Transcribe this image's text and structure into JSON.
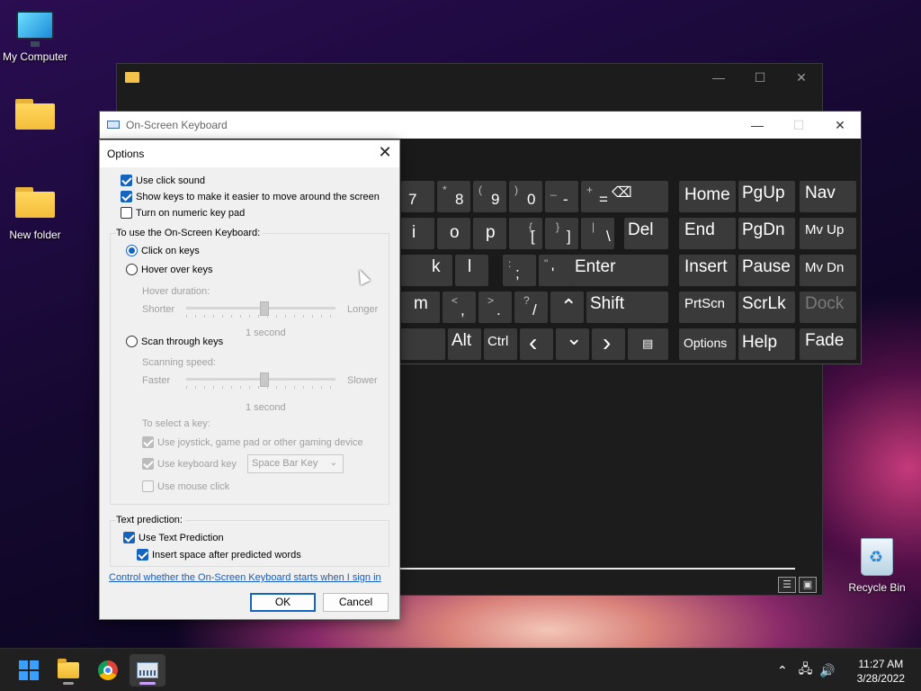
{
  "desktop": {
    "icons": [
      {
        "label": "My Computer"
      },
      {
        "label": ""
      },
      {
        "label": "New folder"
      },
      {
        "label": "Recycle Bin"
      }
    ]
  },
  "osk": {
    "title": "On-Screen Keyboard",
    "keys": {
      "k7": "7",
      "k8": "8",
      "k8_shift": "*",
      "k9": "9",
      "k9_shift": "(",
      "k0": "0",
      "k0_shift": ")",
      "minus": "-",
      "minus_shift": "_",
      "equals": "=",
      "equals_shift": "+",
      "home": "Home",
      "pgup": "PgUp",
      "nav": "Nav",
      "i": "i",
      "o": "o",
      "p": "p",
      "lbracket": "[",
      "lbracket_shift": "{",
      "rbracket": "]",
      "rbracket_shift": "}",
      "backslash": "\\",
      "backslash_shift": "|",
      "del": "Del",
      "end": "End",
      "pgdn": "PgDn",
      "mvup": "Mv Up",
      "k": "k",
      "l": "l",
      "semicolon": ";",
      "semicolon_shift": ":",
      "quote": "'",
      "quote_shift": "\"",
      "enter": "Enter",
      "insert": "Insert",
      "pause": "Pause",
      "mvdn": "Mv Dn",
      "m": "m",
      "comma": ",",
      "comma_shift": "<",
      "period": ".",
      "period_shift": ">",
      "slash": "/",
      "slash_shift": "?",
      "up": "⌃",
      "shift": "Shift",
      "prtscn": "PrtScn",
      "scrlk": "ScrLk",
      "dock": "Dock",
      "alt": "Alt",
      "ctrl": "Ctrl",
      "left": "‹",
      "down": "⌄",
      "right": "›",
      "menu": "▤",
      "options": "Options",
      "help": "Help",
      "fade": "Fade"
    }
  },
  "dialog": {
    "title": "Options",
    "use_click_sound": "Use click sound",
    "show_keys": "Show keys to make it easier to move around the screen",
    "numeric_pad": "Turn on numeric key pad",
    "to_use_group": "To use the On-Screen Keyboard:",
    "click_on_keys": "Click on keys",
    "hover_over_keys": "Hover over keys",
    "hover_duration": "Hover duration:",
    "shorter": "Shorter",
    "longer": "Longer",
    "hover_value": "1 second",
    "scan_through_keys": "Scan through keys",
    "scanning_speed": "Scanning speed:",
    "faster": "Faster",
    "slower": "Slower",
    "scan_value": "1 second",
    "to_select_key": "To select a key:",
    "use_joystick": "Use joystick, game pad or other gaming device",
    "use_keyboard_key": "Use keyboard key",
    "keyboard_key_value": "Space Bar Key",
    "use_mouse_click": "Use mouse click",
    "text_prediction_group": "Text prediction:",
    "use_text_prediction": "Use Text Prediction",
    "insert_space": "Insert space after predicted words",
    "startup_link": "Control whether the On-Screen Keyboard starts when I sign in",
    "ok": "OK",
    "cancel": "Cancel"
  },
  "taskbar": {
    "time": "11:27 AM",
    "date": "3/28/2022"
  },
  "colors": {
    "accent": "#1565c0",
    "osk_key": "#3a3a3a",
    "osk_bg": "#1a1a1a",
    "taskbar": "#202020"
  }
}
